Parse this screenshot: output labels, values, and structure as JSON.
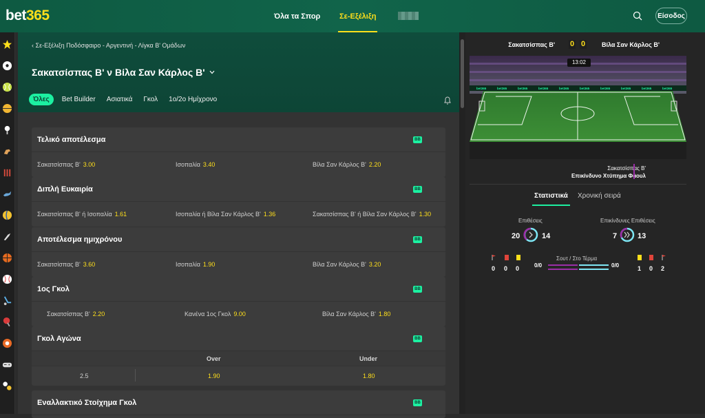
{
  "header": {
    "logo_part1": "bet",
    "logo_part2": "365",
    "nav_all": "Όλα τα Σπορ",
    "nav_live": "Σε-Εξέλιξη",
    "login": "Είσοδος"
  },
  "event": {
    "breadcrumb": "Σε-Εξέλιξη Ποδόσφαιρο - Αργεντινή - Λίγκα Β' Ομάδων",
    "title": "Σακατσίσπας Β' ν Βίλα Σαν Κάρλος Β'",
    "tabs": [
      "Όλες",
      "Bet Builder",
      "Ασιατικά",
      "Γκολ",
      "1ο/2ο Ημίχρονο"
    ]
  },
  "markets": {
    "bb": "BB",
    "m1": {
      "title": "Τελικό αποτέλεσμα",
      "sels": [
        {
          "name": "Σακατσίσπας Β'",
          "odd": "3.00"
        },
        {
          "name": "Ισοπαλία",
          "odd": "3.40"
        },
        {
          "name": "Βίλα Σαν Κάρλος Β'",
          "odd": "2.20"
        }
      ]
    },
    "m2": {
      "title": "Διπλή Ευκαιρία",
      "sels": [
        {
          "name": "Σακατσίσπας Β' ή Ισοπαλία",
          "odd": "1.61"
        },
        {
          "name": "Ισοπαλία ή Βίλα Σαν Κάρλος Β'",
          "odd": "1.36"
        },
        {
          "name": "Σακατσίσπας Β' ή Βίλα Σαν Κάρλος Β'",
          "odd": "1.30"
        }
      ]
    },
    "m3": {
      "title": "Αποτέλεσμα ημιχρόνου",
      "sels": [
        {
          "name": "Σακατσίσπας Β'",
          "odd": "3.60"
        },
        {
          "name": "Ισοπαλία",
          "odd": "1.90"
        },
        {
          "name": "Βίλα Σαν Κάρλος Β'",
          "odd": "3.20"
        }
      ]
    },
    "m4": {
      "title": "1ος Γκολ",
      "sels": [
        {
          "name": "Σακατσίσπας Β'",
          "odd": "2.20"
        },
        {
          "name": "Κανένα 1ος Γκολ",
          "odd": "9.00"
        },
        {
          "name": "Βίλα Σαν Κάρλος Β'",
          "odd": "1.80"
        }
      ]
    },
    "m5": {
      "title": "Γκολ Αγώνα",
      "over": "Over",
      "under": "Under",
      "line": "2.5",
      "over_odd": "1.90",
      "under_odd": "1.80"
    },
    "m6": {
      "title": "Εναλλακτικό Στοίχημα Γκολ"
    }
  },
  "live": {
    "home": "Σακατσίσπας Β'",
    "away": "Βίλα Σαν Κάρλος Β'",
    "home_score": "0",
    "away_score": "0",
    "clock": "13:02",
    "event_team": "Σακατσίσπας Β'",
    "event_desc": "Επικίνδυνο Χτύπημα Φάουλ",
    "tab_stats": "Στατιστικά",
    "tab_timeline": "Χρονική σειρά",
    "attacks_label": "Επιθέσεις",
    "attacks_home": "20",
    "attacks_away": "14",
    "danger_label": "Επικίνδυνες Επιθέσεις",
    "danger_home": "7",
    "danger_away": "13",
    "shots_label": "Σουτ / Στο Τέρμα",
    "shots_home": "0/0",
    "shots_away": "0/0",
    "corners_home": "0",
    "red_home": "0",
    "yellow_home": "0",
    "yellow_away": "1",
    "red_away": "0",
    "corners_away": "2"
  },
  "colors": {
    "accent": "#1cf0a1",
    "odds": "#ffdf1b",
    "header": "#11644a",
    "home": "#9b2ea8",
    "away": "#7ee7f5"
  }
}
